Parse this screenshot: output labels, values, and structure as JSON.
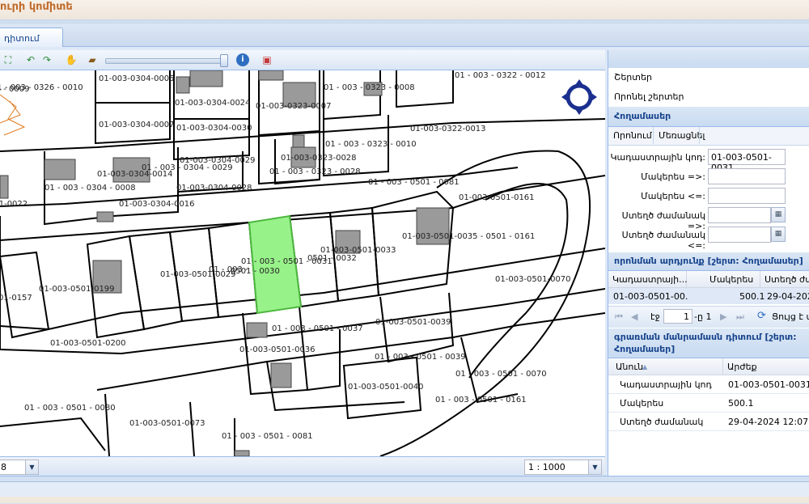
{
  "app": {
    "title": "ուրի կոմիտե"
  },
  "tab": {
    "label": "դիտում"
  },
  "map": {
    "scale": "1 : 1000",
    "zoom_combo": "8",
    "parcels": [
      "01 - 003 - 0326 - 0010",
      "01-003-0304-0005",
      "01 - 003 - 0323 - 0008",
      "01 - 003 - 0322 - 0012",
      "326 - 0009",
      "01-003-0304-0024",
      "01-003-0323-0007",
      "01-003-0304-0007",
      "01-003-0304-0030",
      "01-003-0322-0013",
      "01 - 003 - 0323 - 0010",
      "01-003-0304-0029",
      "01 - 003 - 0304 - 0029",
      "01-003-0323-0028",
      "01-003-0304-0014",
      "01 - 003 - 0323 - 0028",
      "01 - 003 - 0304 - 0008",
      "01-003-0304-0028",
      "01 - 003 - 0501 - 0081",
      "01-003-0501-0161",
      "01-003-0304-0016",
      "501-0022",
      "01-003-0501-0033",
      "01-003-0501-0035 - 0501 - 0161",
      "01 - 003 - 0501 - 0031",
      "0501 - 0032",
      "01-003-0501-0029",
      "01 - 003 -",
      "0501 - 0030",
      "01-003-0501-0070",
      "01-003-0501-0199",
      "01-0157",
      "01 - 003 - 0501 - 0037",
      "01-003-0501-0039",
      "01-003-0501-0200",
      "01-003-0501-0036",
      "01 - 003 - 0501 - 0039",
      "01 - 003 - 0501 - 0070",
      "01-003-0501-0040",
      "01 - 003 - 0501 - 0161",
      "01 - 003 - 0501 - 0080",
      "01-003-0501-0073",
      "01 - 003 - 0501 - 0081"
    ]
  },
  "panel": {
    "layers": "Շերտեր",
    "search_layers": "Որոնել շերտեր",
    "land_header": "Հողամասեր",
    "subtab_search": "Որոնում",
    "subtab_clear": "Մեռացնել",
    "form": {
      "cadastral_label": "Կադաստրային կոդ:",
      "cadastral_value": "01-003-0501-0031",
      "area_min_label": "Մակերես =>:",
      "area_max_label": "Մակերես <=:",
      "date_from_label": "Ստեղծ ժամանակ =>:",
      "date_to_label": "Ստեղծ ժամանակ <=:"
    },
    "results_header": "որոնման արդյունք [շերտ: Հողամասեր]",
    "results_columns": [
      "Կադաստրայի...",
      "Մակերես",
      "Ստեղծ ժամ"
    ],
    "results_row": [
      "01-003-0501-00...",
      "500.1",
      "29-04-2024"
    ],
    "pager": {
      "page_label": "էջ",
      "page_value": "1",
      "of_label": "-ը 1",
      "refresh_label": "Ցույց է տ"
    },
    "details_header": "գրառման մանրամասն դիտում [շերտ: Հողամասեր]",
    "details_columns": [
      "Անուն",
      "Արժեք"
    ],
    "details_rows": [
      {
        "name": "Կադաստրային կոդ",
        "value": "01-003-0501-0031"
      },
      {
        "name": "Մակերես",
        "value": "500.1"
      },
      {
        "name": "Ստեղծ ժամանակ",
        "value": "29-04-2024 12:07:47"
      }
    ]
  },
  "colors": {
    "selected_parcel": "#98f28a",
    "header_text": "#15428b",
    "title_orange": "#c06a2a"
  }
}
